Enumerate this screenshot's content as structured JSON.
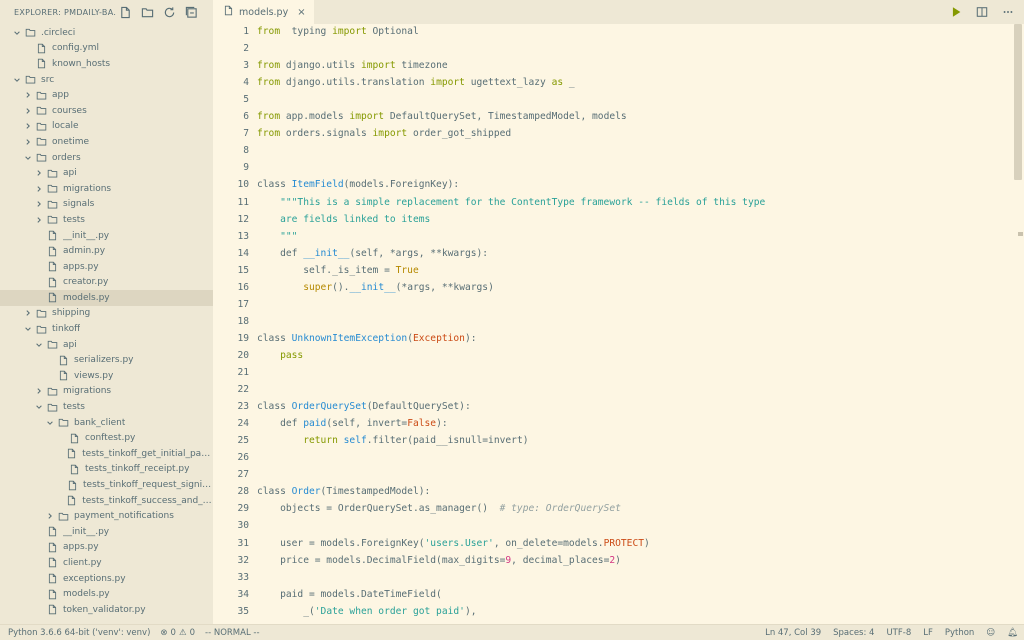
{
  "explorer": {
    "title": "EXPLORER: PMDAILY-BA...",
    "actions": [
      {
        "name": "new-file-icon"
      },
      {
        "name": "new-folder-icon"
      },
      {
        "name": "refresh-icon"
      },
      {
        "name": "collapse-all-icon"
      }
    ],
    "tree": [
      {
        "label": ".circleci",
        "depth": 0,
        "type": "folder",
        "open": true
      },
      {
        "label": "config.yml",
        "depth": 1,
        "type": "file"
      },
      {
        "label": "known_hosts",
        "depth": 1,
        "type": "file"
      },
      {
        "label": "src",
        "depth": 0,
        "type": "folder",
        "open": true
      },
      {
        "label": "app",
        "depth": 1,
        "type": "folder",
        "open": false
      },
      {
        "label": "courses",
        "depth": 1,
        "type": "folder",
        "open": false
      },
      {
        "label": "locale",
        "depth": 1,
        "type": "folder",
        "open": false
      },
      {
        "label": "onetime",
        "depth": 1,
        "type": "folder",
        "open": false
      },
      {
        "label": "orders",
        "depth": 1,
        "type": "folder",
        "open": true
      },
      {
        "label": "api",
        "depth": 2,
        "type": "folder",
        "open": false
      },
      {
        "label": "migrations",
        "depth": 2,
        "type": "folder",
        "open": false
      },
      {
        "label": "signals",
        "depth": 2,
        "type": "folder",
        "open": false
      },
      {
        "label": "tests",
        "depth": 2,
        "type": "folder",
        "open": false
      },
      {
        "label": "__init__.py",
        "depth": 2,
        "type": "file"
      },
      {
        "label": "admin.py",
        "depth": 2,
        "type": "file"
      },
      {
        "label": "apps.py",
        "depth": 2,
        "type": "file"
      },
      {
        "label": "creator.py",
        "depth": 2,
        "type": "file"
      },
      {
        "label": "models.py",
        "depth": 2,
        "type": "file",
        "selected": true
      },
      {
        "label": "shipping",
        "depth": 1,
        "type": "folder",
        "open": false
      },
      {
        "label": "tinkoff",
        "depth": 1,
        "type": "folder",
        "open": true
      },
      {
        "label": "api",
        "depth": 2,
        "type": "folder",
        "open": true
      },
      {
        "label": "serializers.py",
        "depth": 3,
        "type": "file"
      },
      {
        "label": "views.py",
        "depth": 3,
        "type": "file"
      },
      {
        "label": "migrations",
        "depth": 2,
        "type": "folder",
        "open": false
      },
      {
        "label": "tests",
        "depth": 2,
        "type": "folder",
        "open": true
      },
      {
        "label": "bank_client",
        "depth": 3,
        "type": "folder",
        "open": true
      },
      {
        "label": "conftest.py",
        "depth": 4,
        "type": "file"
      },
      {
        "label": "tests_tinkoff_get_initial_payment_...",
        "depth": 4,
        "type": "file"
      },
      {
        "label": "tests_tinkoff_receipt.py",
        "depth": 4,
        "type": "file"
      },
      {
        "label": "tests_tinkoff_request_signing.py",
        "depth": 4,
        "type": "file"
      },
      {
        "label": "tests_tinkoff_success_and_fail_url...",
        "depth": 4,
        "type": "file"
      },
      {
        "label": "payment_notifications",
        "depth": 3,
        "type": "folder",
        "open": false
      },
      {
        "label": "__init__.py",
        "depth": 2,
        "type": "file"
      },
      {
        "label": "apps.py",
        "depth": 2,
        "type": "file"
      },
      {
        "label": "client.py",
        "depth": 2,
        "type": "file"
      },
      {
        "label": "exceptions.py",
        "depth": 2,
        "type": "file"
      },
      {
        "label": "models.py",
        "depth": 2,
        "type": "file"
      },
      {
        "label": "token_validator.py",
        "depth": 2,
        "type": "file"
      }
    ]
  },
  "tab": {
    "label": "models.py",
    "close": "×"
  },
  "tab_actions": [
    {
      "name": "run-icon"
    },
    {
      "name": "split-editor-icon"
    },
    {
      "name": "more-actions-icon"
    }
  ],
  "code": [
    {
      "n": "1",
      "tokens": [
        [
          "kw",
          "from"
        ],
        [
          "",
          "  typing "
        ],
        [
          "kw",
          "import"
        ],
        [
          "",
          " Optional"
        ]
      ]
    },
    {
      "n": "2",
      "tokens": []
    },
    {
      "n": "3",
      "tokens": [
        [
          "kw",
          "from"
        ],
        [
          "",
          " django.utils "
        ],
        [
          "kw",
          "import"
        ],
        [
          "",
          " timezone"
        ]
      ]
    },
    {
      "n": "4",
      "tokens": [
        [
          "kw",
          "from"
        ],
        [
          "",
          " django.utils.translation "
        ],
        [
          "kw",
          "import"
        ],
        [
          "",
          " ugettext_lazy "
        ],
        [
          "kw",
          "as"
        ],
        [
          "",
          " _"
        ]
      ]
    },
    {
      "n": "5",
      "tokens": []
    },
    {
      "n": "6",
      "tokens": [
        [
          "kw",
          "from"
        ],
        [
          "",
          " app.models "
        ],
        [
          "kw",
          "import"
        ],
        [
          "",
          " DefaultQuerySet, TimestampedModel, models"
        ]
      ]
    },
    {
      "n": "7",
      "tokens": [
        [
          "kw",
          "from"
        ],
        [
          "",
          " orders.signals "
        ],
        [
          "kw",
          "import"
        ],
        [
          "",
          " order_got_shipped"
        ]
      ]
    },
    {
      "n": "8",
      "tokens": []
    },
    {
      "n": "9",
      "tokens": []
    },
    {
      "n": "10",
      "tokens": [
        [
          "",
          "class "
        ],
        [
          "fn",
          "ItemField"
        ],
        [
          "",
          "(models.ForeignKey):"
        ]
      ]
    },
    {
      "n": "11",
      "tokens": [
        [
          "str",
          "    \"\"\"This is a simple replacement for the ContentType framework -- fields of this type"
        ]
      ]
    },
    {
      "n": "12",
      "tokens": [
        [
          "str",
          "    are fields linked to items"
        ]
      ]
    },
    {
      "n": "13",
      "tokens": [
        [
          "str",
          "    \"\"\""
        ]
      ]
    },
    {
      "n": "14",
      "tokens": [
        [
          "",
          "    def "
        ],
        [
          "fn",
          "__init__"
        ],
        [
          "",
          "(self, *args, **kwargs):"
        ]
      ]
    },
    {
      "n": "15",
      "tokens": [
        [
          "",
          "        self._is_item = "
        ],
        [
          "const",
          "True"
        ]
      ]
    },
    {
      "n": "16",
      "tokens": [
        [
          "",
          "        "
        ],
        [
          "const",
          "super"
        ],
        [
          "",
          "()."
        ],
        [
          "fn",
          "__init__"
        ],
        [
          "",
          "(*args, **kwargs)"
        ]
      ]
    },
    {
      "n": "17",
      "tokens": []
    },
    {
      "n": "18",
      "tokens": []
    },
    {
      "n": "19",
      "tokens": [
        [
          "",
          "class "
        ],
        [
          "fn",
          "UnknownItemException"
        ],
        [
          "",
          "("
        ],
        [
          "cls",
          "Exception"
        ],
        [
          "",
          "):"
        ]
      ]
    },
    {
      "n": "20",
      "tokens": [
        [
          "kw",
          "    pass"
        ]
      ]
    },
    {
      "n": "21",
      "tokens": []
    },
    {
      "n": "22",
      "tokens": []
    },
    {
      "n": "23",
      "tokens": [
        [
          "",
          "class "
        ],
        [
          "fn",
          "OrderQuerySet"
        ],
        [
          "",
          "(DefaultQuerySet):"
        ]
      ]
    },
    {
      "n": "24",
      "tokens": [
        [
          "",
          "    def "
        ],
        [
          "fn",
          "paid"
        ],
        [
          "",
          "(self, invert="
        ],
        [
          "kwarg",
          "False"
        ],
        [
          "",
          "):"
        ]
      ]
    },
    {
      "n": "25",
      "tokens": [
        [
          "kw",
          "        return"
        ],
        [
          "",
          " "
        ],
        [
          "fn",
          "self"
        ],
        [
          "",
          ".filter(paid__isnull=invert)"
        ]
      ]
    },
    {
      "n": "26",
      "tokens": []
    },
    {
      "n": "27",
      "tokens": []
    },
    {
      "n": "28",
      "tokens": [
        [
          "",
          "class "
        ],
        [
          "fn",
          "Order"
        ],
        [
          "",
          "(TimestampedModel):"
        ]
      ]
    },
    {
      "n": "29",
      "tokens": [
        [
          "",
          "    objects = OrderQuerySet.as_manager()  "
        ],
        [
          "cmt",
          "# type: OrderQuerySet"
        ]
      ]
    },
    {
      "n": "30",
      "tokens": []
    },
    {
      "n": "31",
      "tokens": [
        [
          "",
          "    user = models.ForeignKey("
        ],
        [
          "str",
          "'users.User'"
        ],
        [
          "",
          ", on_delete=models."
        ],
        [
          "cls",
          "PROTECT"
        ],
        [
          "",
          ")"
        ]
      ]
    },
    {
      "n": "32",
      "tokens": [
        [
          "",
          "    price = models.DecimalField(max_digits="
        ],
        [
          "num",
          "9"
        ],
        [
          "",
          ", decimal_places="
        ],
        [
          "num",
          "2"
        ],
        [
          "",
          ")"
        ]
      ]
    },
    {
      "n": "33",
      "tokens": []
    },
    {
      "n": "34",
      "tokens": [
        [
          "",
          "    paid = models.DateTimeField("
        ]
      ]
    },
    {
      "n": "35",
      "tokens": [
        [
          "",
          "        _("
        ],
        [
          "str",
          "'Date when order got paid'"
        ],
        [
          "",
          "),"
        ]
      ]
    }
  ],
  "status": {
    "interpreter": "Python 3.6.6 64-bit ('venv': venv)",
    "errors": "0",
    "warnings": "0",
    "mode": "-- NORMAL --",
    "position": "Ln 47, Col 39",
    "spaces": "Spaces: 4",
    "encoding": "UTF-8",
    "eol": "LF",
    "language": "Python"
  },
  "colors": {
    "run_icon": "#859900",
    "bg": "#fdf6e3",
    "sidebar": "#eee8d5"
  }
}
